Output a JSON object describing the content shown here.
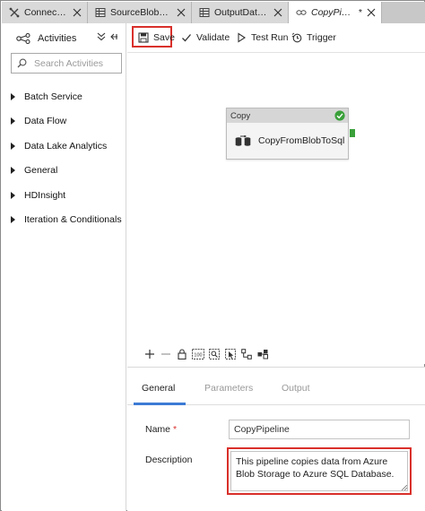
{
  "tabs": [
    {
      "label": "Connections",
      "icon": "connections-icon",
      "active": false
    },
    {
      "label": "SourceBlobDat...",
      "icon": "dataset-table-icon",
      "active": false
    },
    {
      "label": "OutputDataset",
      "icon": "dataset-table-icon",
      "active": false
    },
    {
      "label": "CopyPipeline",
      "dirty": "*",
      "icon": "pipeline-icon",
      "active": true
    }
  ],
  "activities": {
    "title": "Activities",
    "search_placeholder": "Search Activities",
    "categories": [
      "Batch Service",
      "Data Flow",
      "Data Lake Analytics",
      "General",
      "HDInsight",
      "Iteration & Conditionals"
    ]
  },
  "toolbar": {
    "save": "Save",
    "validate": "Validate",
    "test_run": "Test Run",
    "trigger": "Trigger"
  },
  "canvas": {
    "node": {
      "type": "Copy",
      "name": "CopyFromBlobToSql",
      "status_icon": "success-check-icon"
    }
  },
  "properties": {
    "tabs": [
      "General",
      "Parameters",
      "Output"
    ],
    "active_tab": "General",
    "name_label": "Name",
    "required_mark": "*",
    "name_value": "CopyPipeline",
    "description_label": "Description",
    "description_value": "This pipeline copies data from Azure Blob Storage to Azure SQL Database."
  },
  "colors": {
    "highlight": "#d9302b",
    "success": "#3aa03a",
    "accent": "#3c7bd4"
  }
}
